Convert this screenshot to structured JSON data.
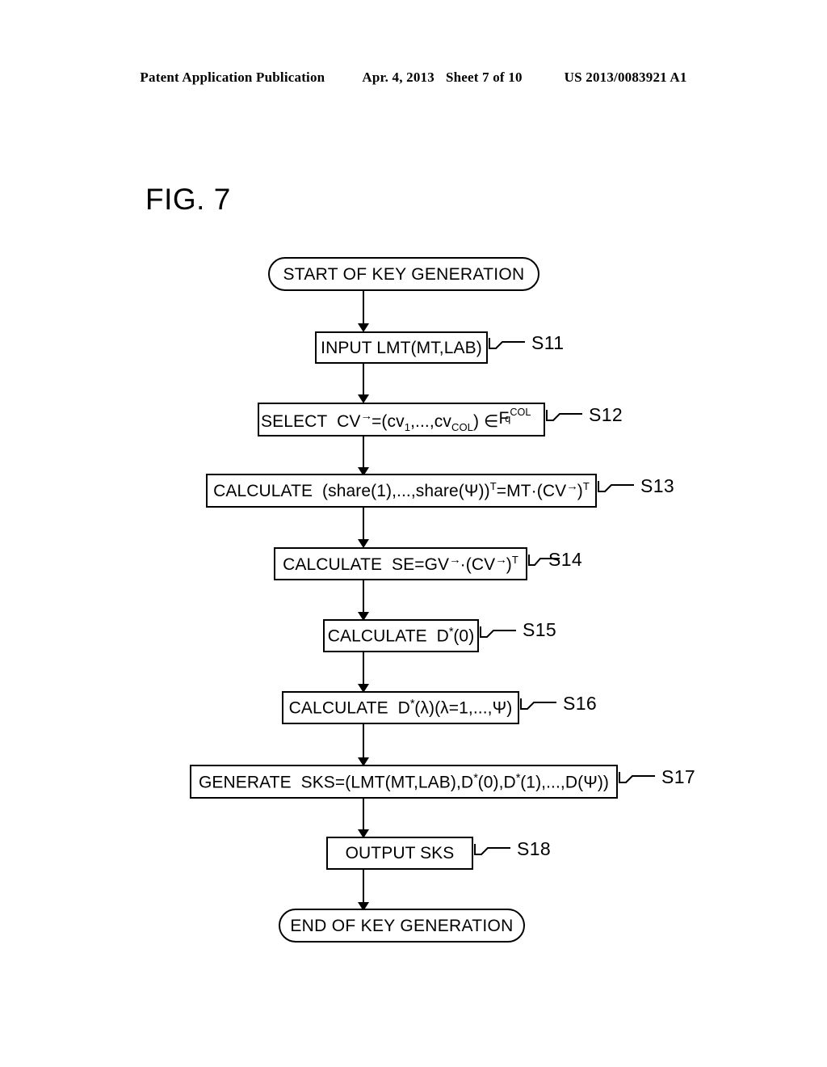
{
  "header": {
    "publication": "Patent Application Publication",
    "date": "Apr. 4, 2013",
    "sheet": "Sheet 7 of 10",
    "document_number": "US 2013/0083921 A1"
  },
  "figure": {
    "title": "FIG. 7"
  },
  "chart_data": {
    "type": "diagram",
    "diagram_type": "flowchart",
    "title": "FIG. 7",
    "orientation": "top-to-bottom",
    "nodes": [
      {
        "id": "start",
        "shape": "terminal",
        "label": "START OF KEY GENERATION",
        "step": null
      },
      {
        "id": "s11",
        "shape": "process",
        "label": "INPUT LMT(MT,LAB)",
        "step": "S11"
      },
      {
        "id": "s12",
        "shape": "process",
        "label": "SELECT  CV→=(cv₁,...,cv_COL) ∈ F_q^COL",
        "step": "S12"
      },
      {
        "id": "s13",
        "shape": "process",
        "label": "CALCULATE  (share(1),...,share(Ψ))ᵀ=MT·(CV→)ᵀ",
        "step": "S13"
      },
      {
        "id": "s14",
        "shape": "process",
        "label": "CALCULATE  SE=GV→·(CV→)ᵀ",
        "step": "S14"
      },
      {
        "id": "s15",
        "shape": "process",
        "label": "CALCULATE  D*(0)",
        "step": "S15"
      },
      {
        "id": "s16",
        "shape": "process",
        "label": "CALCULATE  D*(λ)(λ=1,...,Ψ)",
        "step": "S16"
      },
      {
        "id": "s17",
        "shape": "process",
        "label": "GENERATE  SKS=(LMT(MT,LAB),D*(0),D*(1),...,D(Ψ))",
        "step": "S17"
      },
      {
        "id": "s18",
        "shape": "process",
        "label": "OUTPUT  SKS",
        "step": "S18"
      },
      {
        "id": "end",
        "shape": "terminal",
        "label": "END OF KEY GENERATION",
        "step": null
      }
    ],
    "edges": [
      {
        "from": "start",
        "to": "s11",
        "arrow": true
      },
      {
        "from": "s11",
        "to": "s12",
        "arrow": true
      },
      {
        "from": "s12",
        "to": "s13",
        "arrow": true
      },
      {
        "from": "s13",
        "to": "s14",
        "arrow": true
      },
      {
        "from": "s14",
        "to": "s15",
        "arrow": true
      },
      {
        "from": "s15",
        "to": "s16",
        "arrow": true
      },
      {
        "from": "s16",
        "to": "s17",
        "arrow": true
      },
      {
        "from": "s17",
        "to": "s18",
        "arrow": true
      },
      {
        "from": "s18",
        "to": "end",
        "arrow": true
      }
    ],
    "colors": {
      "stroke": "#000000",
      "fill": "#ffffff",
      "background": "#ffffff"
    }
  },
  "flow": {
    "start": {
      "label": "START OF KEY GENERATION"
    },
    "s11": {
      "label": "INPUT LMT(MT,LAB)",
      "step": "S11"
    },
    "s12": {
      "prefix": "SELECT",
      "cv": "CV",
      "eq_open": "=(cv",
      "sub1": "1",
      "mid": ",...,cv",
      "subcol": "COL",
      "close": ")",
      "elem": "∈",
      "field": "F",
      "field_sub": "q",
      "field_sup": "COL",
      "step": "S12"
    },
    "s13": {
      "prefix": "CALCULATE",
      "body_a": "(share(1),...,share(Ψ))",
      "sup_t1": "T",
      "body_b": "=MT·(CV",
      "body_c": ")",
      "sup_t2": "T",
      "step": "S13"
    },
    "s14": {
      "prefix": "CALCULATE",
      "body_a": "SE=GV",
      "body_b": "·(CV",
      "body_c": ")",
      "sup_t": "T",
      "step": "S14"
    },
    "s15": {
      "prefix": "CALCULATE",
      "body_a": "D",
      "star": "*",
      "body_b": "(0)",
      "step": "S15"
    },
    "s16": {
      "prefix": "CALCULATE",
      "body_a": "D",
      "star": "*",
      "body_b": "(λ)(λ=1,...,Ψ)",
      "step": "S16"
    },
    "s17": {
      "prefix": "GENERATE",
      "body_a": "SKS=(LMT(MT,LAB),D",
      "star1": "*",
      "body_b": "(0),D",
      "star2": "*",
      "body_c": "(1),...,D(Ψ))",
      "step": "S17"
    },
    "s18": {
      "label": "OUTPUT  SKS",
      "step": "S18"
    },
    "end": {
      "label": "END OF KEY GENERATION"
    }
  }
}
